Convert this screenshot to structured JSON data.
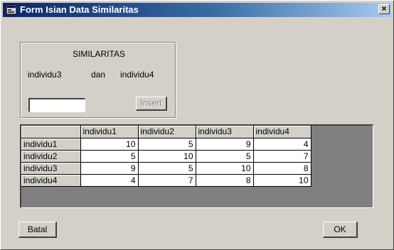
{
  "window": {
    "title": "Form Isian Data Similaritas",
    "close_label": "×"
  },
  "similarity": {
    "title": "SIMILARITAS",
    "left": "individu3",
    "conj": "dan",
    "right": "individu4",
    "input_value": "",
    "insert_label": "Insert"
  },
  "grid": {
    "columns": [
      "individu1",
      "individu2",
      "individu3",
      "individu4"
    ],
    "rows": [
      {
        "label": "individu1",
        "values": [
          "10",
          "5",
          "9",
          "4"
        ]
      },
      {
        "label": "individu2",
        "values": [
          "5",
          "10",
          "5",
          "7"
        ]
      },
      {
        "label": "individu3",
        "values": [
          "9",
          "5",
          "10",
          "8"
        ]
      },
      {
        "label": "individu4",
        "values": [
          "4",
          "7",
          "8",
          "10"
        ]
      }
    ]
  },
  "buttons": {
    "cancel": "Batal",
    "ok": "OK"
  }
}
